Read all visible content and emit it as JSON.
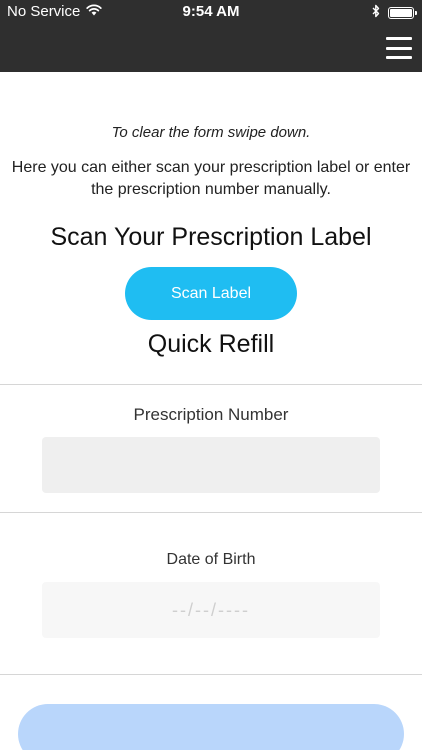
{
  "status_bar": {
    "carrier": "No Service",
    "time": "9:54 AM"
  },
  "icons": {
    "wifi": "wifi-icon",
    "bluetooth": "bluetooth-icon",
    "battery": "battery-icon",
    "menu": "hamburger-menu-icon"
  },
  "colors": {
    "header_background": "#2f2f2f",
    "scan_button": "#1fbdf2",
    "submit_button": "#b9d6fb",
    "input_background": "#efefef"
  },
  "content": {
    "swipe_hint": "To clear the form swipe down.",
    "instructions": "Here you can either scan your prescription label or enter the prescription number manually.",
    "scan_title": "Scan Your Prescription Label",
    "scan_button_label": "Scan Label",
    "refill_title": "Quick Refill"
  },
  "form": {
    "prescription_number_label": "Prescription Number",
    "prescription_number_value": "",
    "date_of_birth_label": "Date of Birth",
    "date_of_birth_placeholder": "--/--/----",
    "submit_label": ""
  }
}
